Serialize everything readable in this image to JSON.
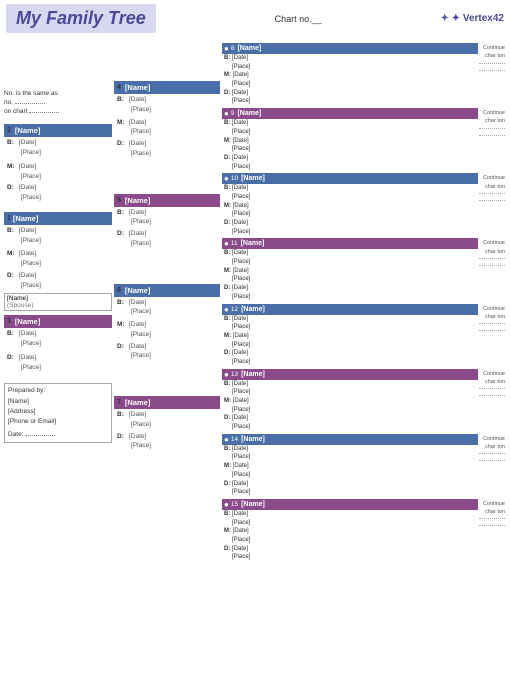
{
  "header": {
    "title": "My Family Tree",
    "chart_no_label": "Chart no.",
    "chart_no_value": "__",
    "logo": "✦ Vertex42"
  },
  "side_info": {
    "note_line1": "No. is the same as",
    "note_line2": "no.",
    "note_line3": "on chart"
  },
  "persons": {
    "p1": {
      "num": "1",
      "name": "[Name]",
      "spouse": "[Name]",
      "spouse_label": "(Spouse)",
      "b_label": "B:",
      "b_date": "[Date]",
      "b_place": "[Place]",
      "m_label": "M:",
      "m_date": "[Date]",
      "m_place": "[Place]",
      "d_label": "D:",
      "d_date": "[Date]",
      "d_place": "[Place]"
    },
    "p2": {
      "num": "2",
      "name": "[Name]",
      "b_label": "B:",
      "b_date": "[Date]",
      "b_place": "[Place]",
      "m_label": "M:",
      "m_date": "[Date]",
      "m_place": "[Place]",
      "d_label": "D:",
      "d_date": "[Date]",
      "d_place": "[Place]"
    },
    "p3": {
      "num": "3",
      "name": "[Name]",
      "b_label": "B:",
      "b_date": "[Date]",
      "b_place": "[Place]",
      "d_label": "D:",
      "d_date": "[Date]",
      "d_place": "[Place]"
    },
    "p4": {
      "num": "4",
      "name": "[Name]",
      "b_label": "B:",
      "b_date": "[Date]",
      "b_place": "[Place]",
      "m_label": "M:",
      "m_date": "[Date]",
      "m_place": "[Place]",
      "d_label": "D:",
      "d_date": "[Date]",
      "d_place": "[Place]"
    },
    "p5": {
      "num": "5",
      "name": "[Name]",
      "b_label": "B:",
      "b_date": "[Date]",
      "b_place": "[Place]",
      "d_label": "D:",
      "d_date": "[Date]",
      "d_place": "[Place]"
    },
    "p6": {
      "num": "6",
      "name": "[Name]",
      "b_label": "B:",
      "b_date": "[Date]",
      "b_place": "[Place]",
      "m_label": "M:",
      "m_date": "[Date]",
      "m_place": "[Place]",
      "d_label": "D:",
      "d_date": "[Date]",
      "d_place": "[Place]"
    },
    "p7": {
      "num": "7",
      "name": "[Name]",
      "b_label": "B:",
      "b_date": "[Date]",
      "b_place": "[Place]",
      "d_label": "D:",
      "d_date": "[Date]",
      "d_place": "[Place]"
    }
  },
  "right_persons": [
    {
      "id": "r1",
      "num": "8",
      "bullet": "●",
      "name": "[Name]",
      "color": "blue",
      "b_label": "B:",
      "b_date": "[Date]",
      "b_place": "[Place]",
      "m_label": "M:",
      "m_date": "[Date]",
      "m_place": "[Place]",
      "d_label": "D:",
      "d_date": "[Date]",
      "d_place": "[Place]",
      "side_note": "Continue\ncharton..."
    },
    {
      "id": "r2",
      "num": "9",
      "bullet": "●",
      "name": "[Name]",
      "color": "purple",
      "b_label": "B:",
      "b_date": "[Date]",
      "b_place": "[Place]",
      "m_label": "M:",
      "m_date": "[Date]",
      "m_place": "[Place]",
      "d_label": "D:",
      "d_date": "[Date]",
      "d_place": "[Place]",
      "side_note": "Continue\ncharton..."
    },
    {
      "id": "r3",
      "num": "10",
      "bullet": "●",
      "name": "[Name]",
      "color": "blue",
      "b_label": "B:",
      "b_date": "[Date]",
      "b_place": "[Place]",
      "m_label": "M:",
      "m_date": "[Date]",
      "m_place": "[Place]",
      "d_label": "D:",
      "d_date": "[Date]",
      "d_place": "[Place]",
      "side_note": "Continue\ncharton..."
    },
    {
      "id": "r4",
      "num": "11",
      "bullet": "●",
      "name": "[Name]",
      "color": "purple",
      "b_label": "B:",
      "b_date": "[Date]",
      "b_place": "[Place]",
      "m_label": "M:",
      "m_date": "[Date]",
      "m_place": "[Place]",
      "d_label": "D:",
      "d_date": "[Date]",
      "d_place": "[Place]",
      "side_note": "Continue\ncharton..."
    },
    {
      "id": "r5",
      "num": "12",
      "bullet": "●",
      "name": "[Name]",
      "color": "blue",
      "b_label": "B:",
      "b_date": "[Date]",
      "b_place": "[Place]",
      "m_label": "M:",
      "m_date": "[Date]",
      "m_place": "[Place]",
      "d_label": "D:",
      "d_date": "[Date]",
      "d_place": "[Place]",
      "side_note": "Continue\ncharton..."
    },
    {
      "id": "r6",
      "num": "13",
      "bullet": "●",
      "name": "[Name]",
      "color": "purple",
      "b_label": "B:",
      "b_date": "[Date]",
      "b_place": "[Place]",
      "m_label": "M:",
      "m_date": "[Date]",
      "m_place": "[Place]",
      "d_label": "D:",
      "d_date": "[Date]",
      "d_place": "[Place]",
      "side_note": "Continue\ncharton..."
    },
    {
      "id": "r7",
      "num": "14",
      "bullet": "●",
      "name": "[Name]",
      "color": "blue",
      "b_label": "B:",
      "b_date": "[Date]",
      "b_place": "[Place]",
      "m_label": "M:",
      "m_date": "[Date]",
      "m_place": "[Place]",
      "d_label": "D:",
      "d_date": "[Date]",
      "d_place": "[Place]",
      "side_note": "Continue\ncharton..."
    },
    {
      "id": "r8",
      "num": "15",
      "bullet": "●",
      "name": "[Name]",
      "color": "purple",
      "b_label": "B:",
      "b_date": "[Date]",
      "b_place": "[Place]",
      "m_label": "M:",
      "m_date": "[Date]",
      "m_place": "[Place]",
      "d_label": "D:",
      "d_date": "[Date]",
      "d_place": "[Place]",
      "side_note": "Continue\ncharton..."
    }
  ],
  "prepared": {
    "label": "Prepared by:",
    "name_label": "[Name]",
    "address_label": "[Address]",
    "phone_label": "[Phone or Email]",
    "date_label": "Date:",
    "date_value": ""
  }
}
